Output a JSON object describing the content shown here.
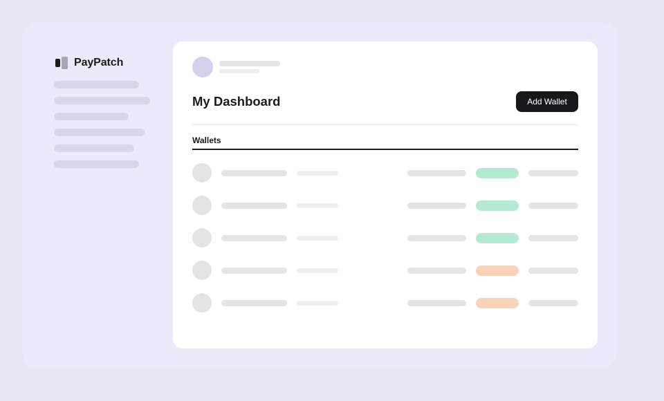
{
  "brand": {
    "name": "PayPatch",
    "icon": "paypatch-logo-icon"
  },
  "sidebar": {
    "items": [
      "",
      "",
      "",
      "",
      "",
      ""
    ]
  },
  "header": {
    "title": "My Dashboard",
    "add_wallet_label": "Add Wallet"
  },
  "tabs": [
    {
      "label": "Wallets",
      "active": true
    }
  ],
  "colors": {
    "status_green": "#b3ead2",
    "status_orange": "#f8d3b7",
    "button_dark": "#18181a",
    "avatar_lavender": "#d3d1ec"
  },
  "wallets": [
    {
      "status": "green"
    },
    {
      "status": "green"
    },
    {
      "status": "green"
    },
    {
      "status": "orange"
    },
    {
      "status": "orange"
    }
  ]
}
